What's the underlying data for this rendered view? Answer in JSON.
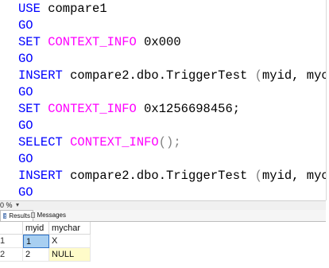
{
  "editor": {
    "lines": [
      {
        "kw1": "USE",
        "rest": " compare1"
      },
      {
        "kw1": "GO"
      },
      {
        "kw1": "SET",
        "fn": " CONTEXT_INFO",
        "rest": " 0x000"
      },
      {
        "kw1": "GO"
      },
      {
        "kw1": "INSERT",
        "rest": " compare2.dbo.TriggerTest ",
        "gray": "(",
        "rest2": "myid, mych"
      },
      {
        "kw1": "GO"
      },
      {
        "kw1": "SET",
        "fn": " CONTEXT_INFO",
        "rest": " 0x1256698456;"
      },
      {
        "kw1": "GO"
      },
      {
        "kw1": "SELECT",
        "fn": " CONTEXT_INFO",
        "gray": "();"
      },
      {
        "kw1": "GO"
      },
      {
        "kw1": "INSERT",
        "rest": " compare2.dbo.TriggerTest ",
        "gray": "(",
        "rest2": "myid, mych"
      },
      {
        "kw1": "GO"
      }
    ]
  },
  "zoom": {
    "value": "0 %"
  },
  "tabs": {
    "results": "Results",
    "messages": "Messages"
  },
  "results": {
    "columns": [
      "myid",
      "mychar"
    ],
    "rows": [
      {
        "num": "1",
        "myid": "1",
        "mychar": "X"
      },
      {
        "num": "2",
        "myid": "2",
        "mychar": "NULL"
      }
    ]
  },
  "colors": {
    "keyword": "#0000ff",
    "function": "#ff00ff",
    "operator": "#808080",
    "selection": "#a8cff1",
    "null_highlight": "#fffbc9"
  }
}
